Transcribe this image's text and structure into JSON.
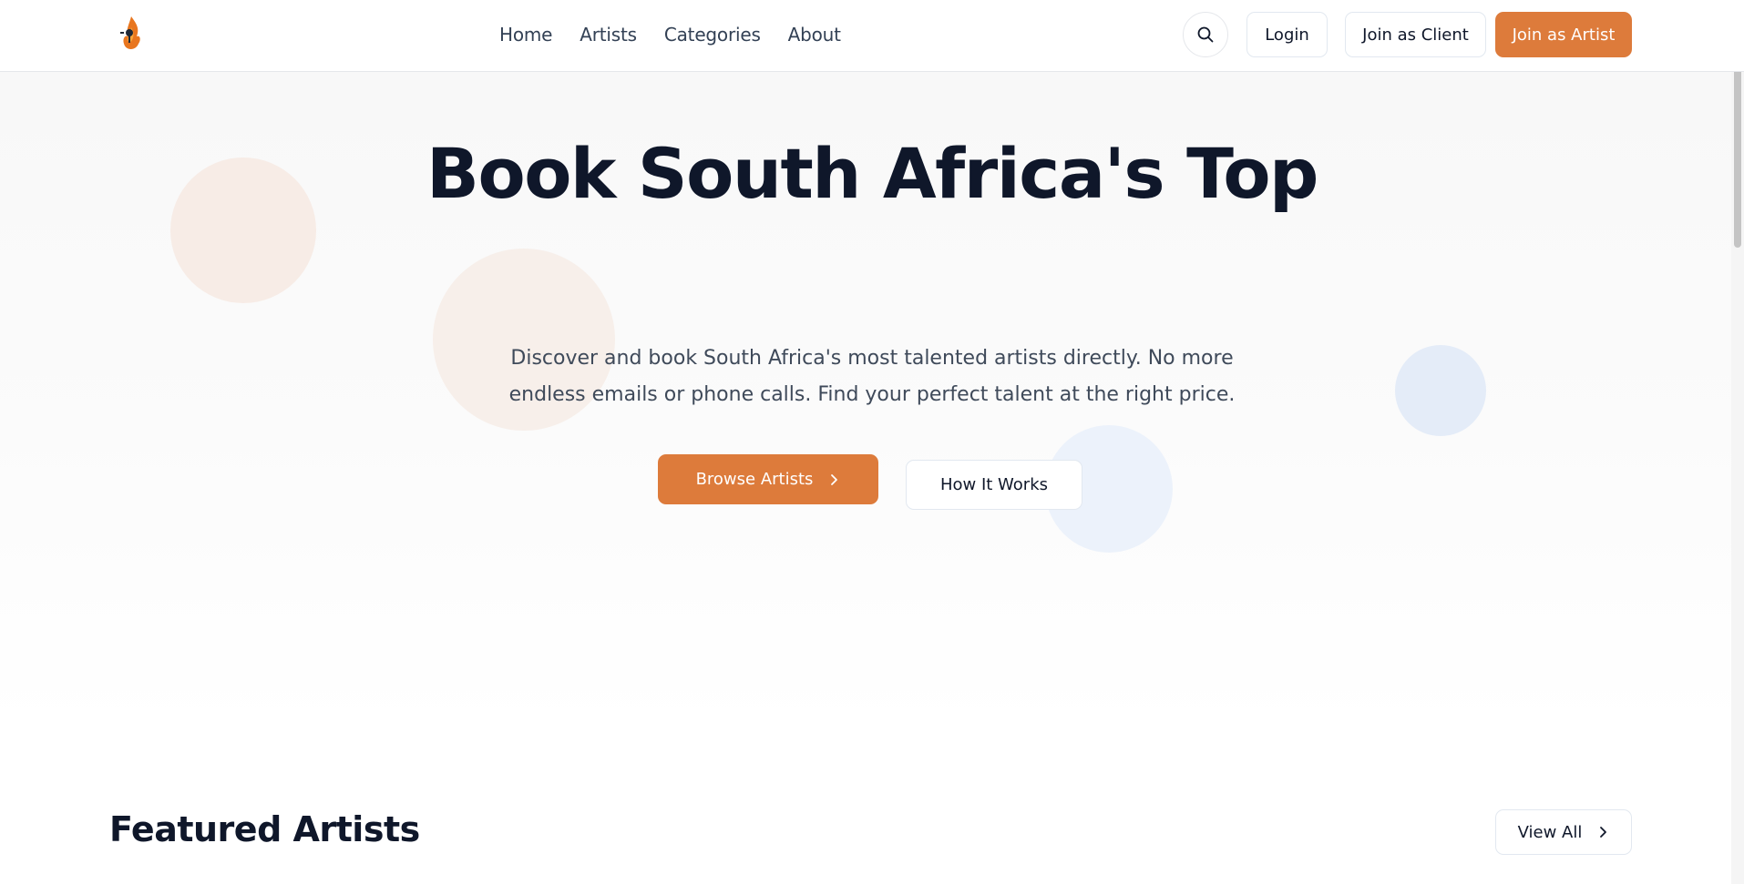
{
  "header": {
    "logo_icon": "flame-microphone-logo",
    "nav": [
      {
        "label": "Home"
      },
      {
        "label": "Artists"
      },
      {
        "label": "Categories"
      },
      {
        "label": "About"
      }
    ],
    "search_icon": "search-icon",
    "login_label": "Login",
    "join_client_label": "Join as Client",
    "join_artist_label": "Join as Artist"
  },
  "hero": {
    "title": "Book South Africa's Top",
    "subtitle_line1": "Discover and book South Africa's most talented artists directly. No more",
    "subtitle_line2": "endless emails or phone calls. Find your perfect talent at the right price.",
    "browse_label": "Browse Artists",
    "how_label": "How It Works"
  },
  "featured": {
    "title": "Featured Artists",
    "view_all_label": "View All"
  },
  "colors": {
    "accent": "#dd7b3b",
    "text_dark": "#0f172a",
    "text_muted": "#3f4a5a",
    "border": "#e2e8f0"
  }
}
